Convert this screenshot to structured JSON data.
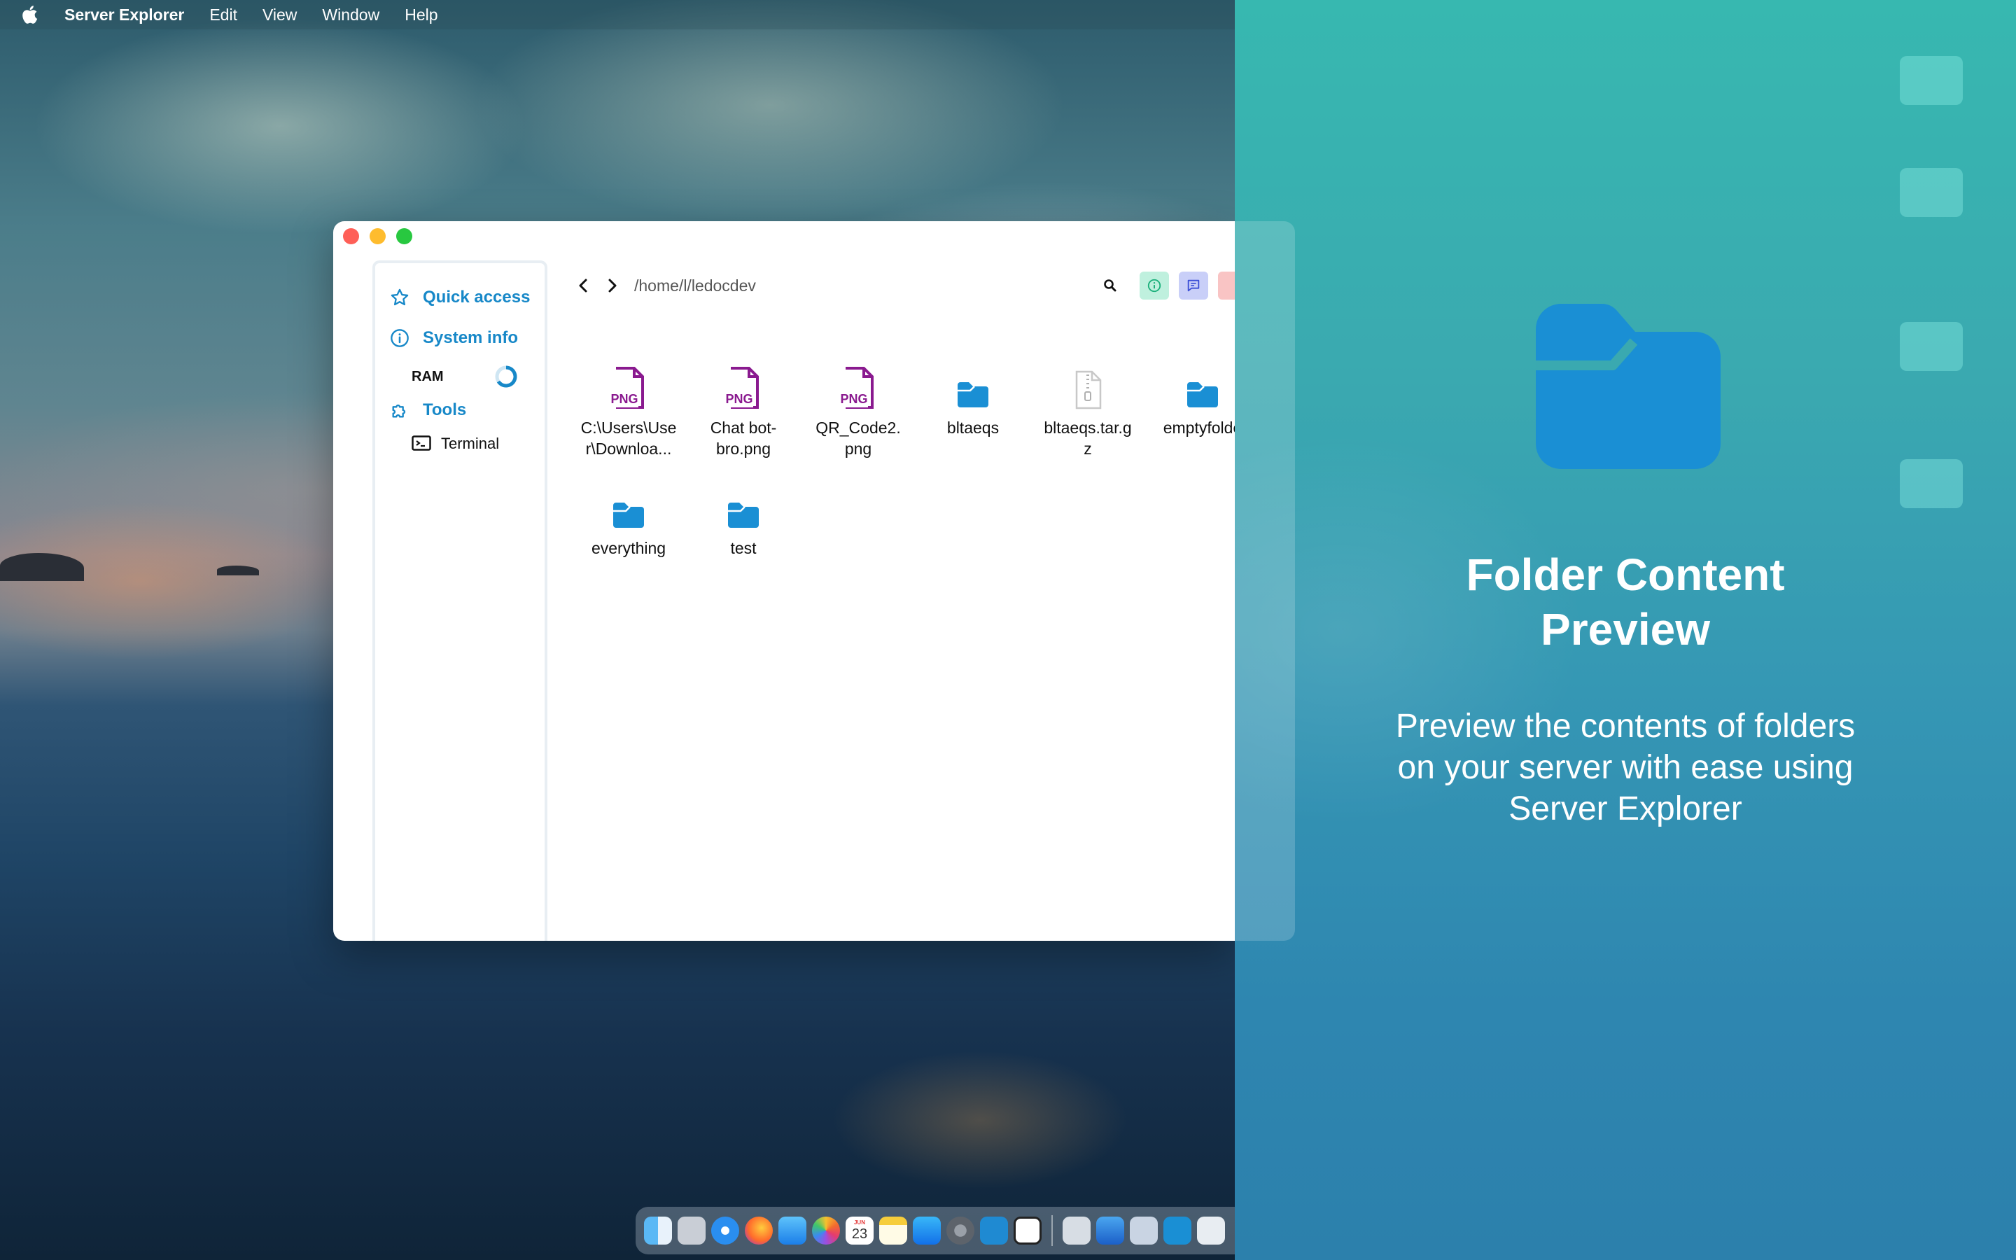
{
  "menubar": {
    "app_name": "Server Explorer",
    "items": [
      "Edit",
      "View",
      "Window",
      "Help"
    ]
  },
  "sidebar": {
    "quick_access": "Quick access",
    "system_info": "System info",
    "ram_label": "RAM",
    "tools": "Tools",
    "terminal": "Terminal"
  },
  "toolbar": {
    "path": "/home/l/ledocdev"
  },
  "files": [
    {
      "name": "C:\\Users\\User\\Downloa...",
      "line1": "C:\\Users\\Use",
      "line2": "r\\Downloa...",
      "type": "png"
    },
    {
      "name": "Chat bot-bro.png",
      "line1": "Chat bot-",
      "line2": "bro.png",
      "type": "png"
    },
    {
      "name": "QR_Code2.png",
      "line1": "QR_Code2.",
      "line2": "png",
      "type": "png"
    },
    {
      "name": "bltaeqs",
      "line1": "bltaeqs",
      "line2": "",
      "type": "folder"
    },
    {
      "name": "bltaeqs.tar.gz",
      "line1": "bltaeqs.tar.g",
      "line2": "z",
      "type": "archive"
    },
    {
      "name": "emptyfolde",
      "line1": "emptyfolde",
      "line2": "",
      "type": "folder"
    },
    {
      "name": "everything",
      "line1": "everything",
      "line2": "",
      "type": "folder"
    },
    {
      "name": "test",
      "line1": "test",
      "line2": "",
      "type": "folder"
    }
  ],
  "png_badge": "PNG",
  "promo": {
    "title_line1": "Folder Content",
    "title_line2": "Preview",
    "sub_line1": "Preview the contents of folders",
    "sub_line2": "on your server with ease using",
    "sub_line3": "Server Explorer"
  },
  "dock": {
    "calendar_month": "JUN",
    "calendar_day": "23"
  },
  "colors": {
    "accent": "#1788c8",
    "folder": "#1a8fd4",
    "png_icon": "#8a1a8f",
    "promo_bg": "#3597b4"
  }
}
